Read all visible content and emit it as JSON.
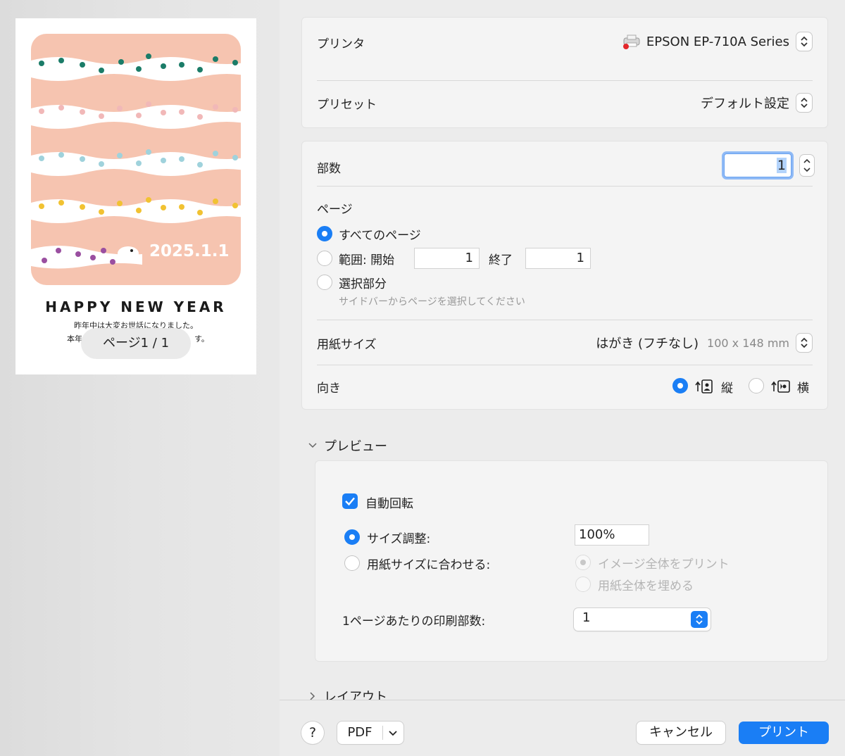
{
  "preview": {
    "card_date": "2025.1.1",
    "card_greeting": "HAPPY NEW YEAR",
    "card_line1": "昨年中は大変お世話になりました。",
    "card_line2_left": "本年",
    "card_line2_right": "す。",
    "page_indicator": "ページ1 / 1"
  },
  "printer": {
    "label": "プリンタ",
    "value": "EPSON EP-710A Series",
    "icon": "printer-icon"
  },
  "preset": {
    "label": "プリセット",
    "value": "デフォルト設定"
  },
  "copies": {
    "label": "部数",
    "value": "1"
  },
  "pages": {
    "label": "ページ",
    "all_label": "すべてのページ",
    "range_label": "範囲: 開始",
    "range_from": "1",
    "range_to_label": "終了",
    "range_to": "1",
    "selection_label": "選択部分",
    "selection_hint": "サイドバーからページを選択してください",
    "selected": "all"
  },
  "paper_size": {
    "label": "用紙サイズ",
    "value": "はがき (フチなし)",
    "dimensions": "100 x 148 mm"
  },
  "orientation": {
    "label": "向き",
    "portrait_label": "縦",
    "landscape_label": "横",
    "selected": "portrait"
  },
  "preview_section": {
    "title": "プレビュー",
    "auto_rotate_label": "自動回転",
    "auto_rotate_checked": true,
    "scale_label": "サイズ調整:",
    "scale_value": "100%",
    "fit_label": "用紙サイズに合わせる:",
    "fit_option_whole": "イメージ全体をプリント",
    "fit_option_fill": "用紙全体を埋める",
    "pages_per_sheet_label": "1ページあたりの印刷部数:",
    "pages_per_sheet_value": "1"
  },
  "layout_section": {
    "title": "レイアウト"
  },
  "footer": {
    "help_label": "?",
    "pdf_label": "PDF",
    "cancel_label": "キャンセル",
    "print_label": "プリント"
  },
  "colors": {
    "accent": "#1a7ef5",
    "card_pink": "#f6c4b0",
    "dot_teal": "#1b7c68",
    "dot_pink": "#f1b8b8",
    "dot_blue": "#9fd2dc",
    "dot_yellow": "#f1c232",
    "dot_purple": "#9a4fa0"
  }
}
